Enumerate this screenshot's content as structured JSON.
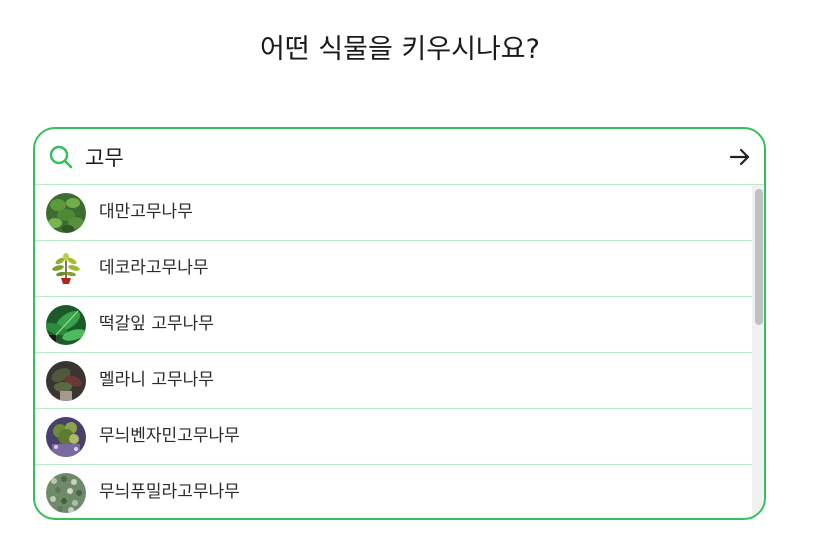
{
  "page": {
    "title": "어떤 식물을 키우시나요?"
  },
  "search": {
    "value": "고무",
    "placeholder": "",
    "icon": "search-icon",
    "submit_icon": "arrow-right-icon",
    "accent_color": "#34c05a"
  },
  "results": [
    {
      "label": "대만고무나무",
      "thumb": "plant-thumbnail"
    },
    {
      "label": "데코라고무나무",
      "thumb": "plant-thumbnail"
    },
    {
      "label": "떡갈잎 고무나무",
      "thumb": "plant-thumbnail"
    },
    {
      "label": "멜라니 고무나무",
      "thumb": "plant-thumbnail"
    },
    {
      "label": "무늬벤자민고무나무",
      "thumb": "plant-thumbnail"
    },
    {
      "label": "무늬푸밀라고무나무",
      "thumb": "plant-thumbnail"
    }
  ]
}
